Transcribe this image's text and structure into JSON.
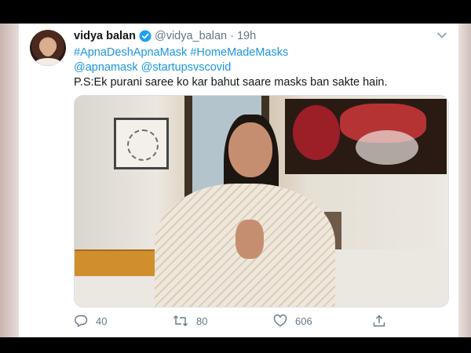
{
  "tweet": {
    "display_name": "vidya balan",
    "handle": "@vidya_balan",
    "separator": "·",
    "time": "19h",
    "line1_tags": [
      "#ApnaDeshApnaMask",
      "#HomeMadeMasks"
    ],
    "line2_tags": [
      "@apnamask",
      "@startupsvscovid"
    ],
    "line3_text": "P.S:Ek purani saree ko  kar bahut saare masks ban sakte hain."
  },
  "actions": {
    "reply_count": "40",
    "retweet_count": "80",
    "like_count": "606"
  },
  "colors": {
    "link": "#1b95e0",
    "text": "#14171a",
    "muted": "#657786",
    "verified": "#1da1f2"
  },
  "icons": [
    "verified-badge-icon",
    "chevron-down-icon",
    "reply-icon",
    "retweet-icon",
    "heart-icon",
    "share-icon"
  ]
}
